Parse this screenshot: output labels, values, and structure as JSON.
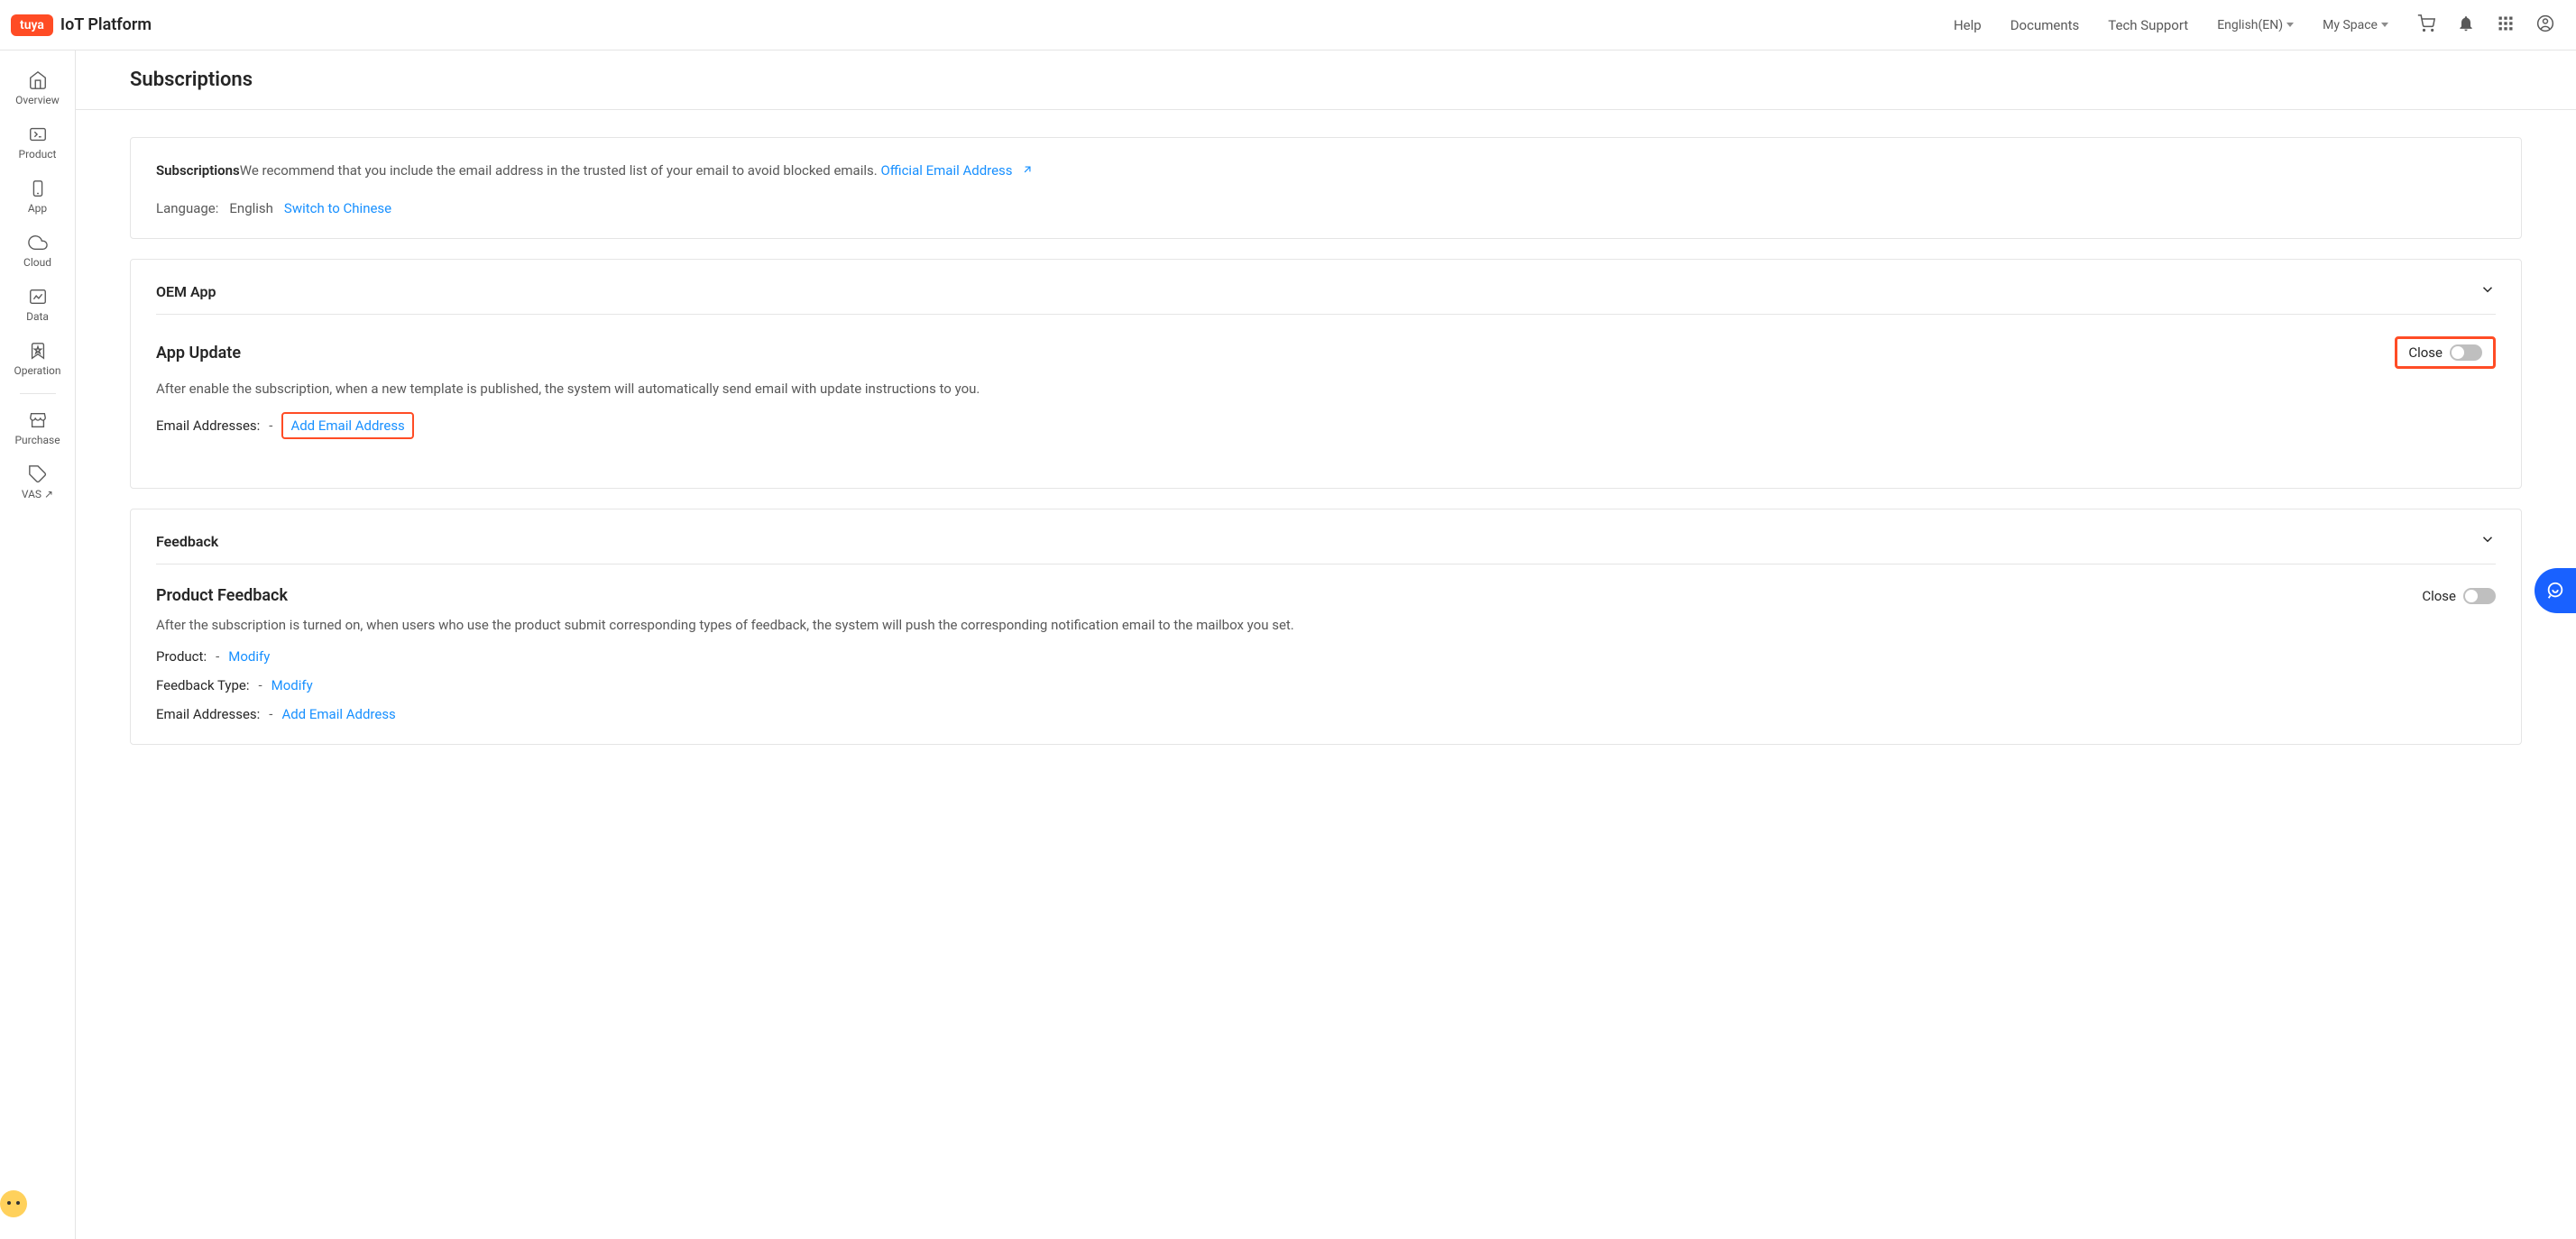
{
  "logo": {
    "badge": "tuya",
    "text": "IoT Platform"
  },
  "header_nav": {
    "help": "Help",
    "documents": "Documents",
    "tech_support": "Tech Support",
    "language": "English(EN)",
    "my_space": "My Space"
  },
  "sidebar": {
    "overview": "Overview",
    "product": "Product",
    "app": "App",
    "cloud": "Cloud",
    "data": "Data",
    "operation": "Operation",
    "purchase": "Purchase",
    "vas": "VAS"
  },
  "page": {
    "title": "Subscriptions"
  },
  "notice": {
    "prefix": "Subscriptions",
    "text": "We recommend that you include the email address in the trusted list of your email to avoid blocked emails.",
    "link": "Official Email Address",
    "lang_label": "Language:",
    "lang_value": "English",
    "lang_switch": "Switch to Chinese"
  },
  "oem": {
    "title": "OEM App",
    "sub_title": "App Update",
    "sub_desc": "After enable the subscription, when a new template is published, the system will automatically send email with update instructions to you.",
    "toggle_label": "Close",
    "email_label": "Email Addresses:",
    "email_value": "-",
    "add_email": "Add Email Address"
  },
  "feedback": {
    "title": "Feedback",
    "sub_title": "Product Feedback",
    "sub_desc": "After the subscription is turned on, when users who use the product submit corresponding types of feedback, the system will push the corresponding notification email to the mailbox you set.",
    "toggle_label": "Close",
    "product_label": "Product:",
    "product_value": "-",
    "product_modify": "Modify",
    "type_label": "Feedback Type:",
    "type_value": "-",
    "type_modify": "Modify",
    "email_label": "Email Addresses:",
    "email_value": "-",
    "add_email": "Add Email Address"
  }
}
